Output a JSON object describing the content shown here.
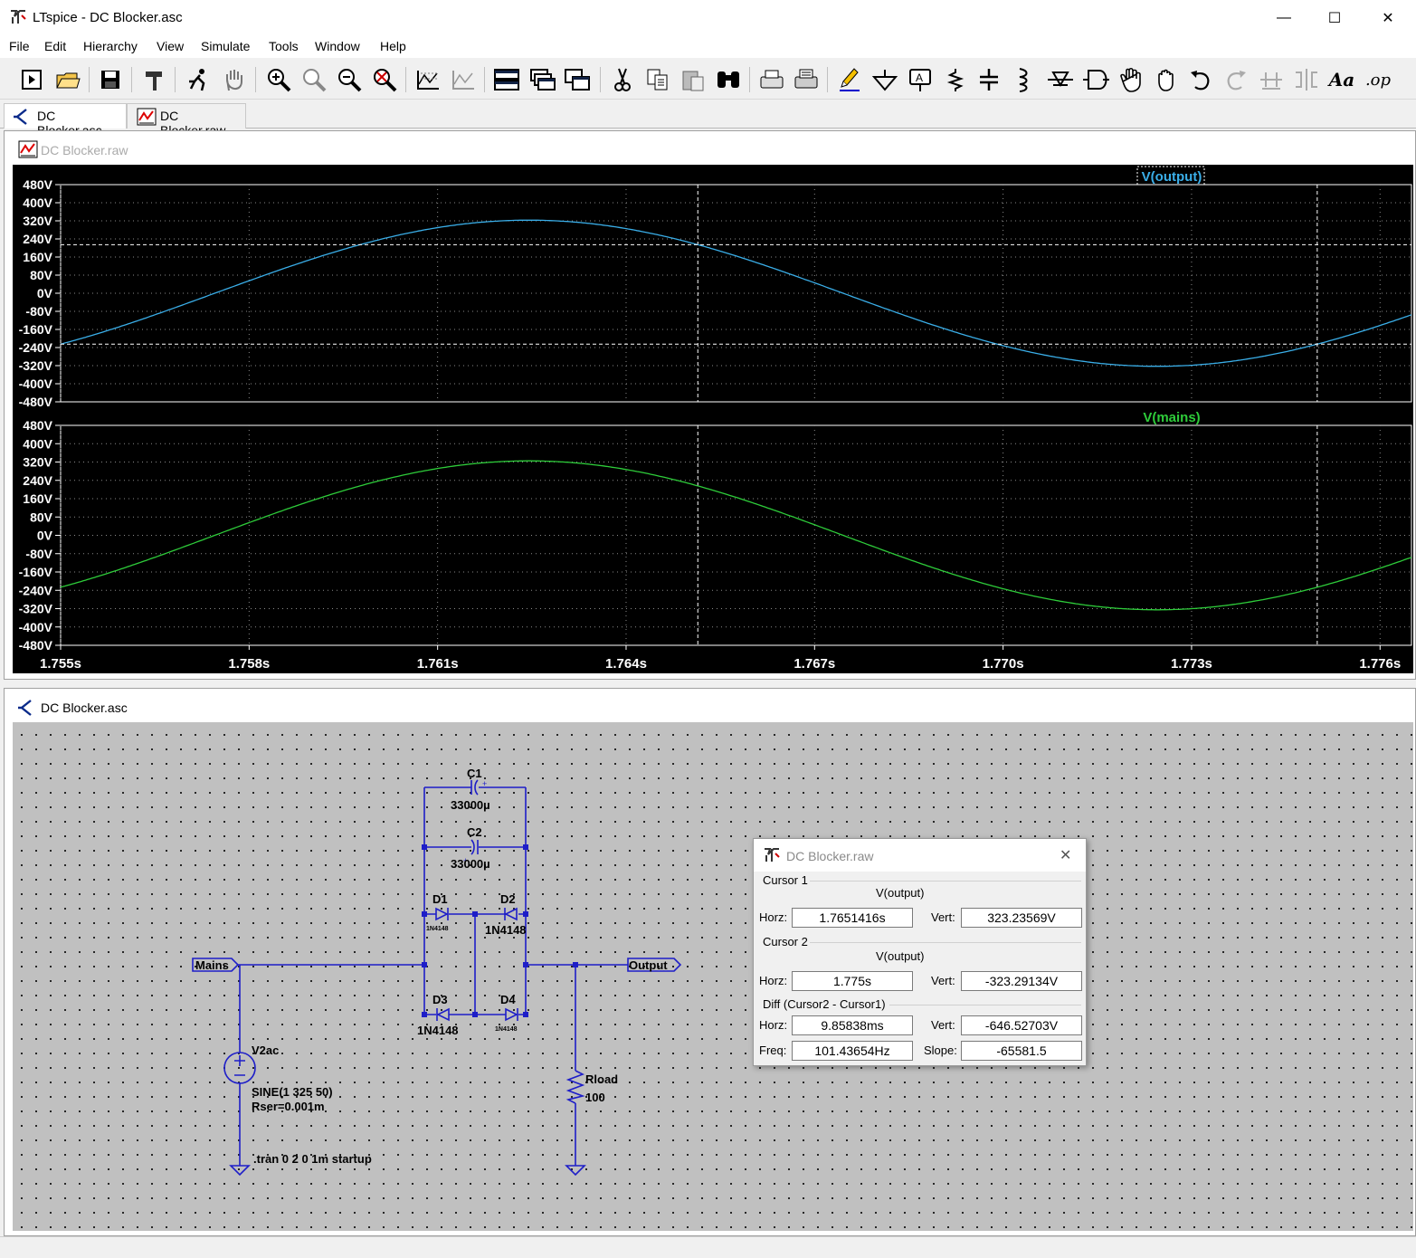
{
  "window": {
    "title": "LTspice - DC Blocker.asc",
    "minimize": "—",
    "maximize": "☐",
    "close": "✕"
  },
  "menu": [
    "File",
    "Edit",
    "Hierarchy",
    "View",
    "Simulate",
    "Tools",
    "Window",
    "Help"
  ],
  "toolbar": {
    "icons": [
      "new-schematic-icon",
      "open-folder-icon",
      "save-icon",
      "control-panel-hammer-icon",
      "run-simulation-icon",
      "halt-hand-icon",
      "zoom-in-icon",
      "zoom-pan-icon",
      "zoom-out-icon",
      "zoom-fit-icon",
      "autorange-icon",
      "delete-plot-icon",
      "tile-horizontal-icon",
      "cascade-icon",
      "tile-vertical-icon",
      "cut-icon",
      "copy-icon",
      "paste-icon",
      "find-icon",
      "print-setup-icon",
      "print-icon",
      "draw-wire-icon",
      "ground-icon",
      "label-net-icon",
      "resistor-icon",
      "capacitor-icon",
      "inductor-icon",
      "diode-icon",
      "component-icon",
      "move-hand-icon",
      "drag-hand-icon",
      "undo-icon",
      "redo-icon",
      "rotate-icon",
      "mirror-icon",
      "text-icon",
      "spice-directive-icon"
    ],
    "text_aa": "Aa",
    "text_op": ".op"
  },
  "tabs": [
    {
      "label": "DC Blocker.asc",
      "active": true
    },
    {
      "label": "DC Blocker.raw",
      "active": false
    }
  ],
  "plot_window": {
    "title": "DC Blocker.raw"
  },
  "schematic_window": {
    "title": "DC Blocker.asc"
  },
  "chart_data": {
    "type": "line",
    "x_ticks": [
      "1.755s",
      "1.758s",
      "1.761s",
      "1.764s",
      "1.767s",
      "1.770s",
      "1.773s",
      "1.776s"
    ],
    "xlim": [
      1.755,
      1.7765
    ],
    "y_ticks": [
      "480V",
      "400V",
      "320V",
      "240V",
      "160V",
      "80V",
      "0V",
      "-80V",
      "-160V",
      "-240V",
      "-320V",
      "-400V",
      "-480V"
    ],
    "ylim": [
      -480,
      480
    ],
    "grid": true,
    "panes": [
      {
        "name": "V(output)",
        "color": "#3aaee8",
        "amplitude": 323,
        "frequency": 50,
        "wave": "sine"
      },
      {
        "name": "V(mains)",
        "color": "#2ecc3a",
        "amplitude": 325,
        "frequency": 50,
        "wave": "sine"
      }
    ],
    "cursors": [
      1.7651416,
      1.775
    ]
  },
  "schematic": {
    "components": {
      "c1": {
        "name": "C1",
        "value": "33000µ"
      },
      "c2": {
        "name": "C2",
        "value": "33000µ"
      },
      "d1": {
        "name": "D1",
        "model": "1N4148"
      },
      "d2": {
        "name": "D2",
        "model": "1N4148"
      },
      "d3": {
        "name": "D3",
        "model": "1N4148"
      },
      "d4": {
        "name": "D4",
        "model": "1N4148"
      },
      "v2": {
        "name": "V2ac",
        "value": "SINE(1 325 50)",
        "param": "Rser=0.001m"
      },
      "rload": {
        "name": "Rload",
        "value": "100"
      }
    },
    "labels": {
      "mains": "Mains",
      "output": "Output"
    },
    "directive": ".tran 0 2 0 1m startup"
  },
  "cursor_dialog": {
    "title": "DC Blocker.raw",
    "cursor1": {
      "label": "Cursor 1",
      "trace": "V(output)",
      "horz_label": "Horz:",
      "horz": "1.7651416s",
      "vert_label": "Vert:",
      "vert": "323.23569V"
    },
    "cursor2": {
      "label": "Cursor 2",
      "trace": "V(output)",
      "horz_label": "Horz:",
      "horz": "1.775s",
      "vert_label": "Vert:",
      "vert": "-323.29134V"
    },
    "diff": {
      "label": "Diff (Cursor2 - Cursor1)",
      "horz_label": "Horz:",
      "horz": "9.85838ms",
      "vert_label": "Vert:",
      "vert": "-646.52703V",
      "freq_label": "Freq:",
      "freq": "101.43654Hz",
      "slope_label": "Slope:",
      "slope": "-65581.5"
    }
  }
}
